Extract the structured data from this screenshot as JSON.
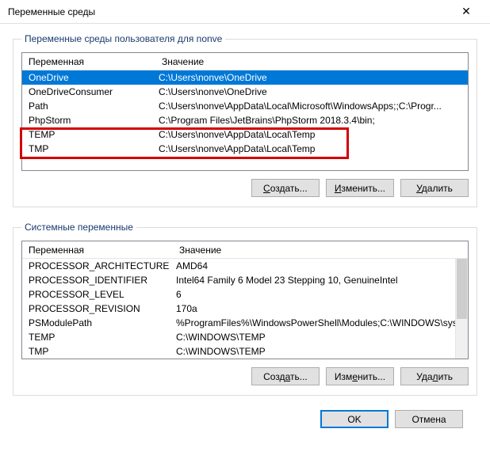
{
  "title": "Переменные среды",
  "user_group_label": "Переменные среды пользователя для nonve",
  "columns": {
    "name": "Переменная",
    "value": "Значение"
  },
  "user_vars": [
    {
      "name": "OneDrive",
      "value": "C:\\Users\\nonve\\OneDrive",
      "selected": true
    },
    {
      "name": "OneDriveConsumer",
      "value": "C:\\Users\\nonve\\OneDrive"
    },
    {
      "name": "Path",
      "value": "C:\\Users\\nonve\\AppData\\Local\\Microsoft\\WindowsApps;;C:\\Progr..."
    },
    {
      "name": "PhpStorm",
      "value": "C:\\Program Files\\JetBrains\\PhpStorm 2018.3.4\\bin;"
    },
    {
      "name": "TEMP",
      "value": "C:\\Users\\nonve\\AppData\\Local\\Temp"
    },
    {
      "name": "TMP",
      "value": "C:\\Users\\nonve\\AppData\\Local\\Temp"
    }
  ],
  "sys_group_label": "Системные переменные",
  "sys_vars": [
    {
      "name": "PROCESSOR_ARCHITECTURE",
      "value": "AMD64"
    },
    {
      "name": "PROCESSOR_IDENTIFIER",
      "value": "Intel64 Family 6 Model 23 Stepping 10, GenuineIntel"
    },
    {
      "name": "PROCESSOR_LEVEL",
      "value": "6"
    },
    {
      "name": "PROCESSOR_REVISION",
      "value": "170a"
    },
    {
      "name": "PSModulePath",
      "value": "%ProgramFiles%\\WindowsPowerShell\\Modules;C:\\WINDOWS\\syst..."
    },
    {
      "name": "TEMP",
      "value": "C:\\WINDOWS\\TEMP"
    },
    {
      "name": "TMP",
      "value": "C:\\WINDOWS\\TEMP"
    }
  ],
  "buttons": {
    "create": "Создать...",
    "edit": "Изменить...",
    "delete": "Удалить",
    "ok": "OK",
    "cancel": "Отмена"
  }
}
